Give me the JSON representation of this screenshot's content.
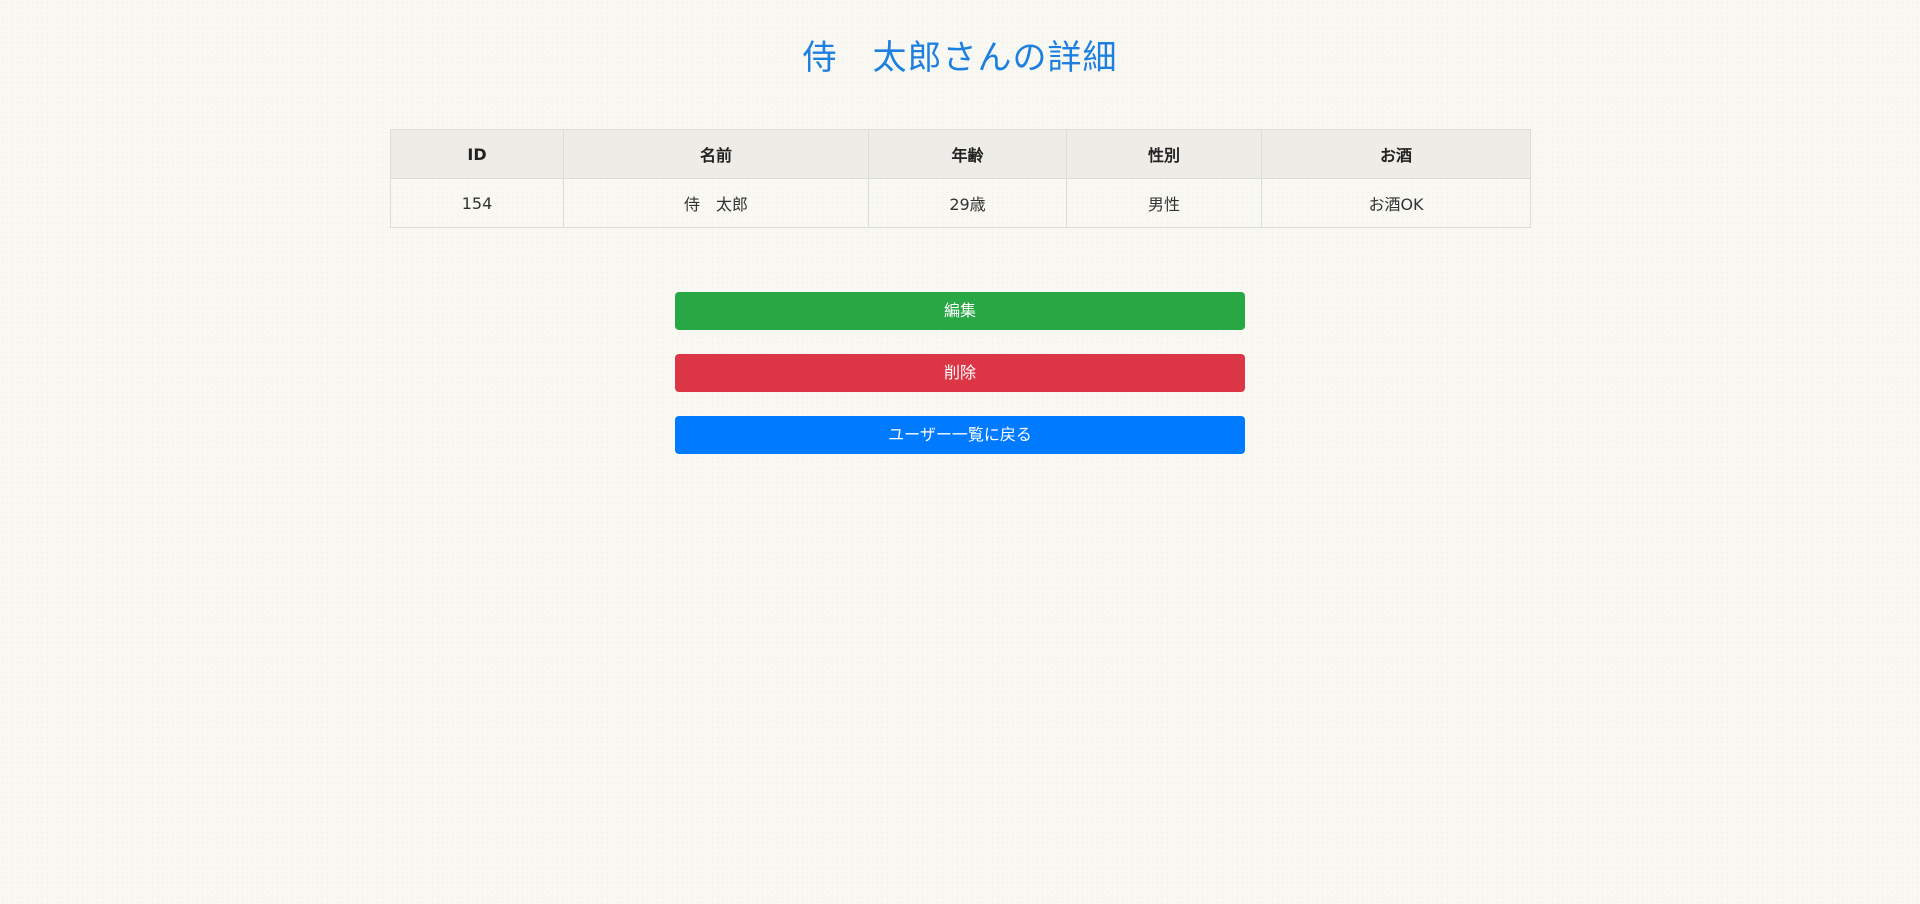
{
  "page": {
    "title": "侍　太郎さんの詳細"
  },
  "table": {
    "headers": [
      "ID",
      "名前",
      "年齢",
      "性別",
      "お酒"
    ],
    "row": [
      "154",
      "侍　太郎",
      "29歳",
      "男性",
      "お酒OK"
    ]
  },
  "actions": {
    "edit_label": "編集",
    "delete_label": "削除",
    "back_label": "ユーザー一覧に戻る"
  },
  "colors": {
    "title": "#1d7fe0",
    "edit": "#28a745",
    "delete": "#dc3545",
    "back": "#007bff",
    "header_bg": "#eeece6",
    "page_bg": "#f9f8f2"
  }
}
